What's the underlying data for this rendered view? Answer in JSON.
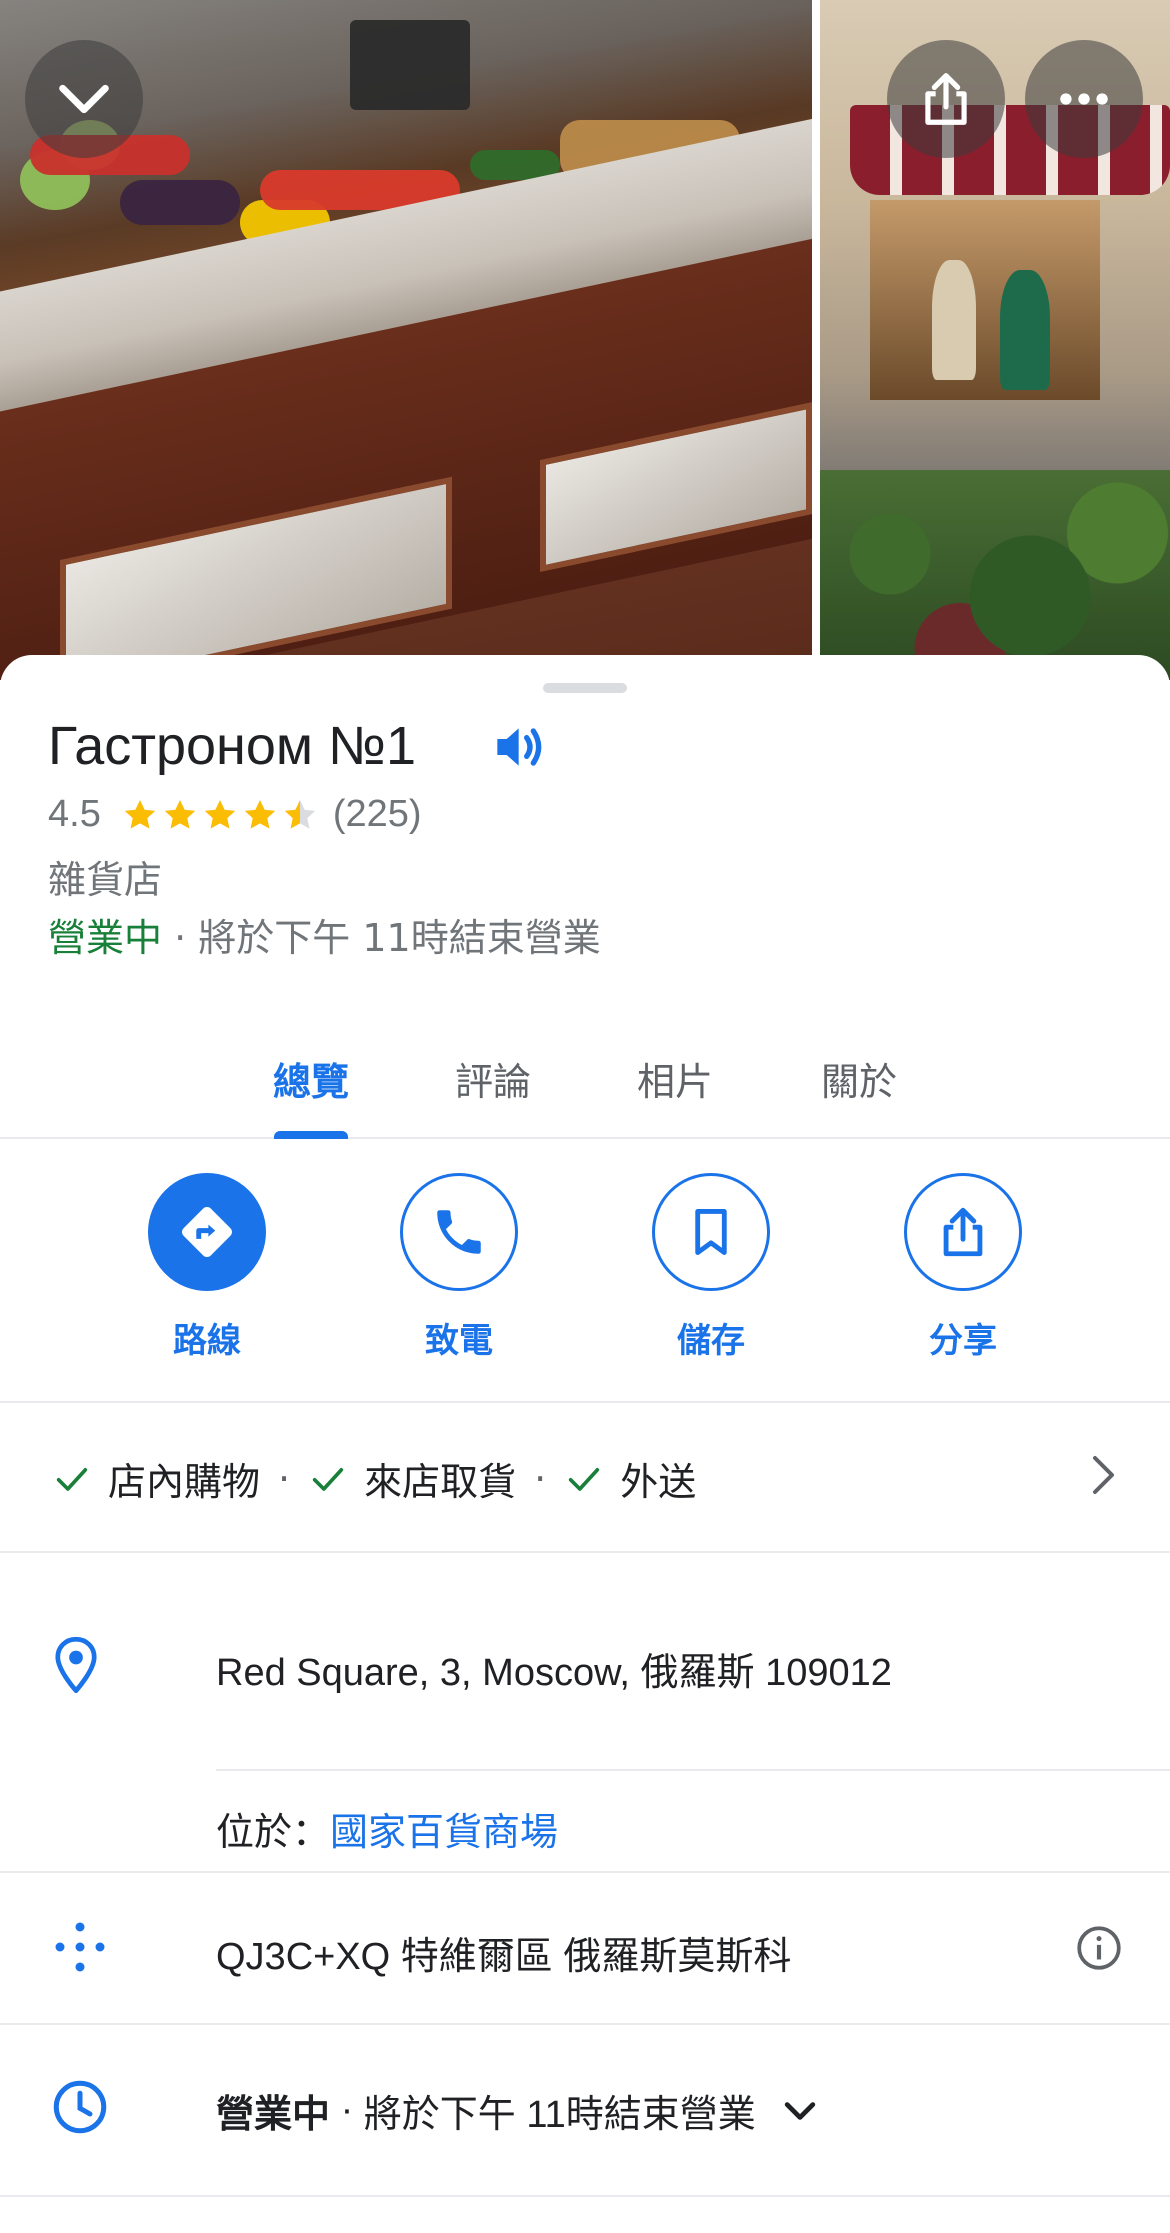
{
  "place": {
    "name": "Гастроном №1",
    "rating": "4.5",
    "rating_value": 4.5,
    "review_count": "(225)",
    "category": "雜貨店",
    "open_status": "營業中",
    "separator": " · ",
    "closing_text": "將於下午 11時結束營業"
  },
  "tabs": [
    {
      "label": "總覽",
      "active": true
    },
    {
      "label": "評論",
      "active": false
    },
    {
      "label": "相片",
      "active": false
    },
    {
      "label": "關於",
      "active": false
    }
  ],
  "actions": [
    {
      "label": "路線",
      "icon": "directions-icon"
    },
    {
      "label": "致電",
      "icon": "phone-icon"
    },
    {
      "label": "儲存",
      "icon": "bookmark-icon"
    },
    {
      "label": "分享",
      "icon": "share-icon"
    }
  ],
  "services": {
    "items": [
      "店內購物",
      "來店取貨",
      "外送"
    ],
    "dot": "·"
  },
  "address": {
    "text": "Red Square, 3, Moscow, 俄羅斯 109012",
    "located_in_label": "位於：",
    "located_in_value": "國家百貨商場"
  },
  "plus_code": {
    "text": "QJ3C+XQ 特維爾區 俄羅斯莫斯科"
  },
  "hours": {
    "open_status": "營業中",
    "separator": " · ",
    "closing_text": "將於下午 11時結束營業"
  },
  "colors": {
    "accent": "#1a73e8",
    "open": "#188038",
    "star": "#fbbc04",
    "secondary_text": "#70757a"
  }
}
